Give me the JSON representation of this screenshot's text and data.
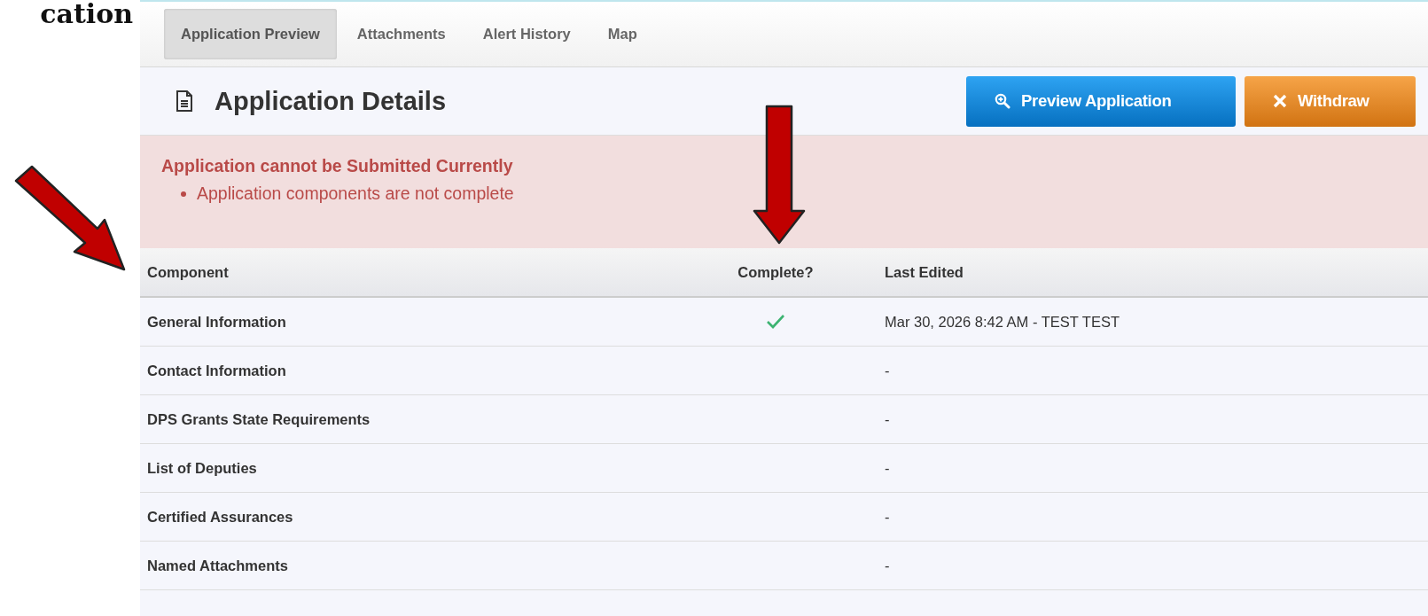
{
  "page_heading_fragment": "cation",
  "tabs": [
    {
      "label": "Application Preview",
      "selected": true
    },
    {
      "label": "Attachments",
      "selected": false
    },
    {
      "label": "Alert History",
      "selected": false
    },
    {
      "label": "Map",
      "selected": false
    }
  ],
  "panel": {
    "title": "Application Details",
    "buttons": [
      {
        "kind": "preview",
        "label": "Preview Application"
      },
      {
        "kind": "withdraw",
        "label": "Withdraw"
      }
    ]
  },
  "alert": {
    "title": "Application cannot be Submitted Currently",
    "items": [
      "Application components are not complete"
    ]
  },
  "table": {
    "columns": [
      "Component",
      "Complete?",
      "Last Edited"
    ],
    "rows": [
      {
        "component": "General Information",
        "complete": true,
        "last_edited": "Mar 30, 2026 8:42 AM - TEST TEST"
      },
      {
        "component": "Contact Information",
        "complete": false,
        "last_edited": "-"
      },
      {
        "component": "DPS Grants State Requirements",
        "complete": false,
        "last_edited": "-"
      },
      {
        "component": "List of Deputies",
        "complete": false,
        "last_edited": "-"
      },
      {
        "component": "Certified Assurances",
        "complete": false,
        "last_edited": "-"
      },
      {
        "component": "Named Attachments",
        "complete": false,
        "last_edited": "-"
      }
    ]
  }
}
